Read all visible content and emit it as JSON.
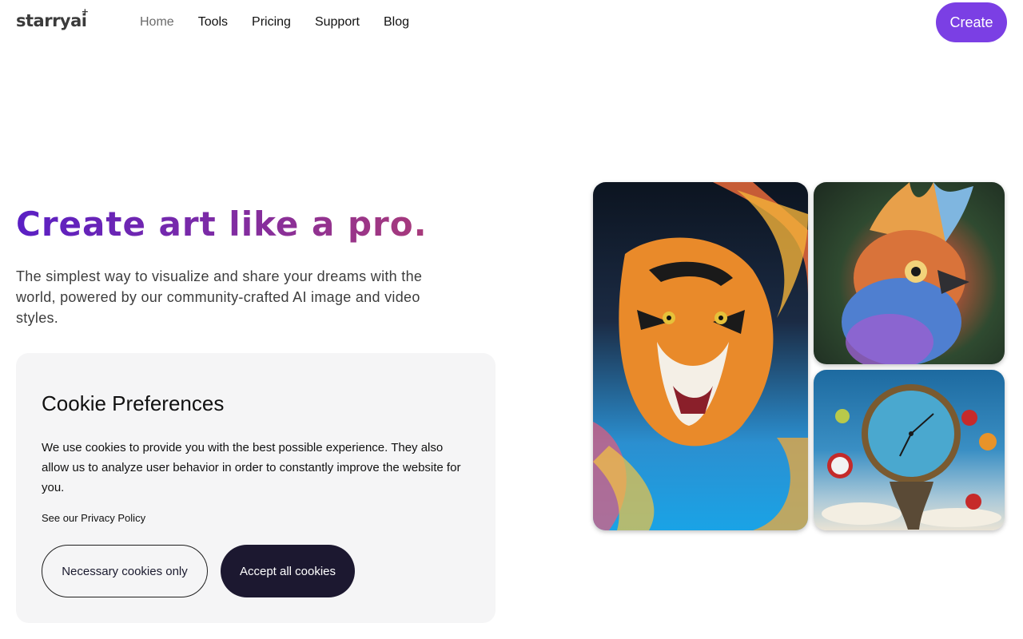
{
  "brand": {
    "logo_text": "starryai",
    "logo_star": "+"
  },
  "nav": {
    "items": [
      {
        "label": "Home",
        "active": true
      },
      {
        "label": "Tools",
        "active": false
      },
      {
        "label": "Pricing",
        "active": false
      },
      {
        "label": "Support",
        "active": false
      },
      {
        "label": "Blog",
        "active": false
      }
    ],
    "cta_label": "Create",
    "cta_color": "#7b3fe4"
  },
  "hero": {
    "title": "Create art like a pro.",
    "subtitle": "The simplest way to visualize and share your dreams with the world, powered by our community-crafted AI image and video styles."
  },
  "cookie_banner": {
    "title": "Cookie Preferences",
    "description": "We use cookies to provide you with the best possible experience. They also allow us to analyze user behavior in order to constantly improve the website for you.",
    "policy_prefix": "See our ",
    "policy_link": "Privacy Policy",
    "necessary_label": "Necessary cookies only",
    "accept_label": "Accept all cookies",
    "accept_color": "#1c1830"
  },
  "gallery": [
    {
      "subject": "tiger-splash-art"
    },
    {
      "subject": "colorful-bird-art"
    },
    {
      "subject": "melting-clock-art"
    }
  ]
}
